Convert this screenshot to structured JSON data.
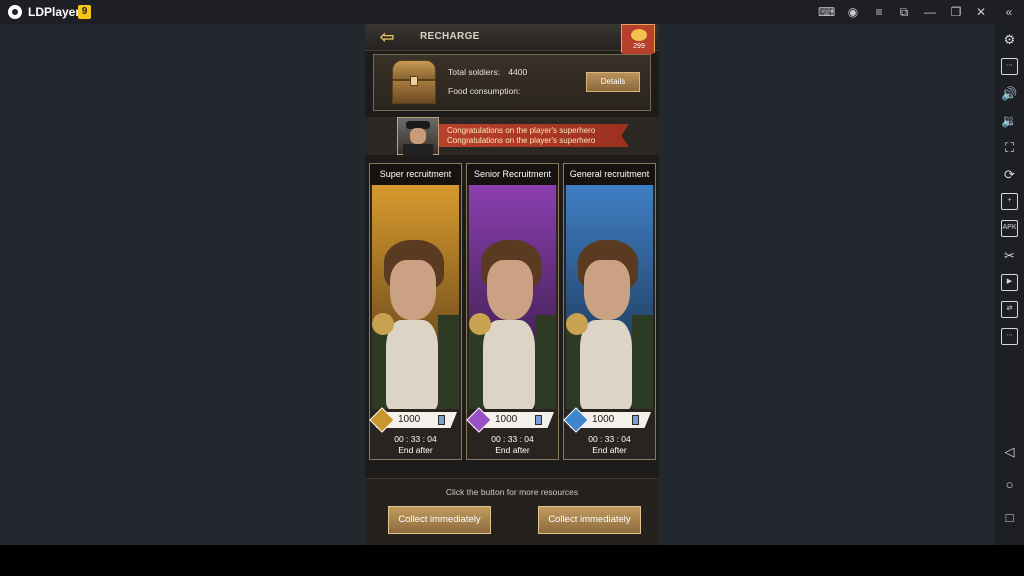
{
  "emulator": {
    "title": "LDPlayer",
    "version": "9",
    "title_icons": [
      "gamepad-icon",
      "account-icon",
      "menu-icon",
      "screen-icon",
      "minimize-icon",
      "restore-icon",
      "close-icon",
      "collapse-icon"
    ],
    "sidebar_icons": [
      "settings-icon",
      "keyboard-icon",
      "volume-up-icon",
      "volume-down-icon",
      "screenshot-icon",
      "rotate-icon",
      "add-app-icon",
      "apk-icon",
      "scissors-icon",
      "video-icon",
      "sync-icon",
      "more-icon",
      "back-nav-icon",
      "home-nav-icon",
      "recents-nav-icon"
    ],
    "sidebar_apk_label": "APK"
  },
  "game": {
    "header": {
      "back_icon": "arrow-left-icon",
      "title": "RECHARGE",
      "vip_value": "299"
    },
    "info": {
      "total_soldiers_label": "Total soldiers:",
      "total_soldiers_value": "4400",
      "food_label": "Food consumption:",
      "details_label": "Details"
    },
    "banner": {
      "line1": "Congratulations on the player's superhero",
      "line2": "Congratulations on the player's superhero"
    },
    "cards": [
      {
        "title": "Super recruitment",
        "cost": "1000",
        "timer": "00 : 33 : 04",
        "end_label": "End after",
        "color_top": "#d89a2e",
        "color_bottom": "#4a3216",
        "diamond_color": "#c8952e"
      },
      {
        "title": "Senior Recruitment",
        "cost": "1000",
        "timer": "00 : 33 : 04",
        "end_label": "End after",
        "color_top": "#8b3fb0",
        "color_bottom": "#2a1636",
        "diamond_color": "#9b4fc4"
      },
      {
        "title": "General recruitment",
        "cost": "1000",
        "timer": "00 : 33 : 04",
        "end_label": "End after",
        "color_top": "#3f7fc4",
        "color_bottom": "#16283e",
        "diamond_color": "#3f86cc"
      }
    ],
    "footer": {
      "hint": "Click the button for more resources",
      "collect_left": "Collect immediately",
      "collect_right": "Collect immediately"
    }
  }
}
